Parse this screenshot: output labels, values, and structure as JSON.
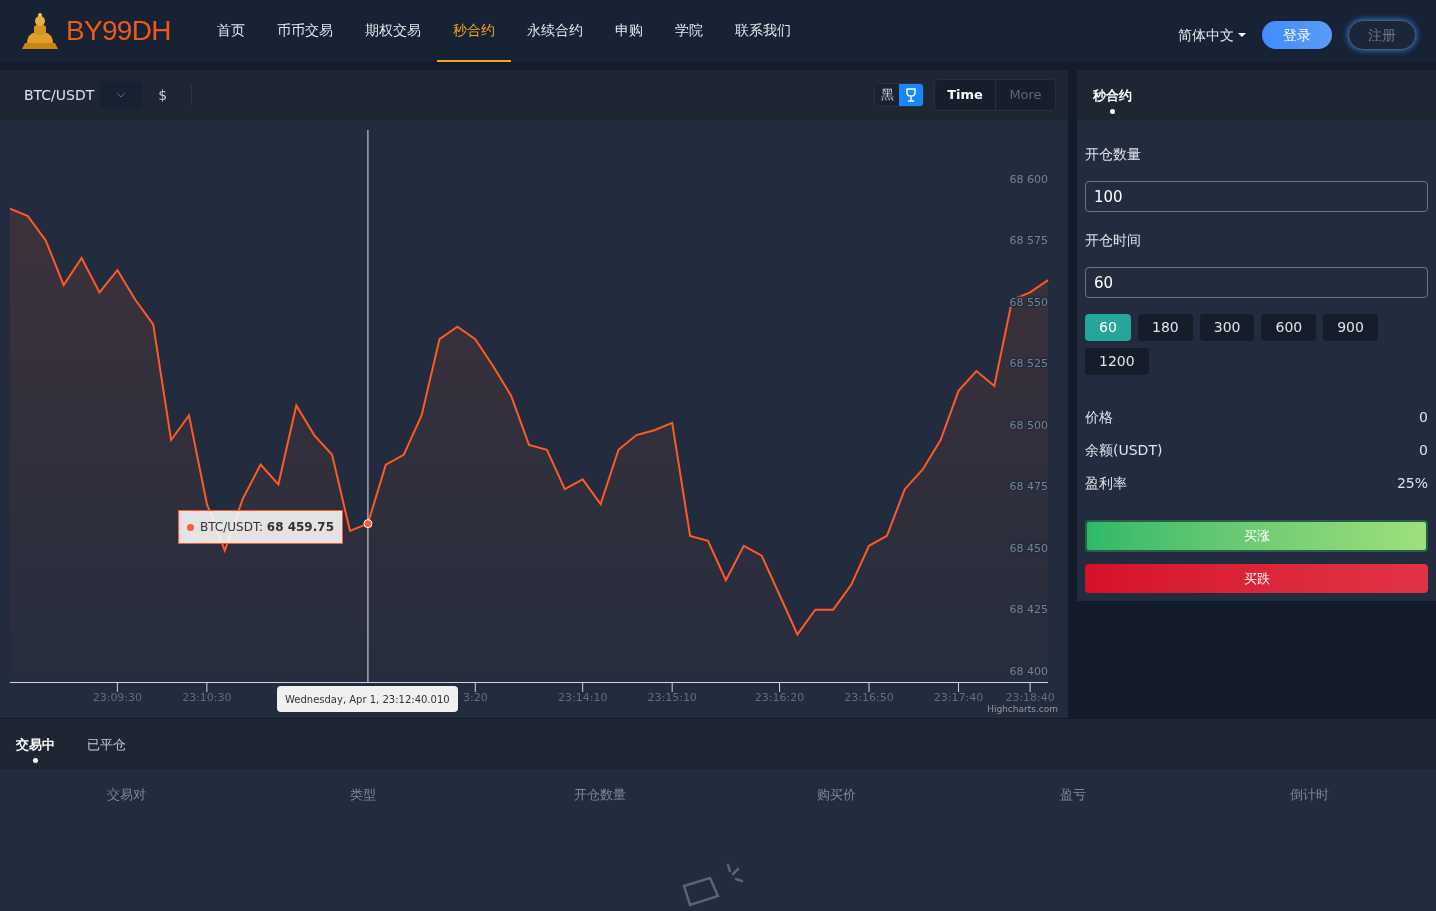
{
  "header": {
    "logo": "BY99DH",
    "nav": [
      {
        "label": "首页",
        "selected": false
      },
      {
        "label": "币币交易",
        "selected": false
      },
      {
        "label": "期权交易",
        "selected": false
      },
      {
        "label": "秒合约",
        "selected": true
      },
      {
        "label": "永续合约",
        "selected": false
      },
      {
        "label": "申购",
        "selected": false
      },
      {
        "label": "学院",
        "selected": false
      },
      {
        "label": "联系我们",
        "selected": false
      }
    ],
    "language": "简体中文",
    "login": "登录",
    "register": "注册"
  },
  "chart_panel": {
    "symbol": "BTC/USDT",
    "currency": "$",
    "theme_toggle": [
      {
        "kind": "text",
        "label": "黑",
        "selected": false
      },
      {
        "kind": "icon",
        "selected": true
      }
    ],
    "range_tabs": [
      {
        "label": "Time",
        "selected": true
      },
      {
        "label": "More",
        "selected": false
      }
    ],
    "chart_data": {
      "type": "area",
      "categories": [
        null,
        null,
        null,
        null,
        null,
        null,
        "23:09:30",
        null,
        null,
        null,
        null,
        "23:10:30",
        null,
        null,
        null,
        null,
        null,
        null,
        null,
        null,
        null,
        null,
        null,
        null,
        null,
        null,
        "3:20",
        null,
        null,
        null,
        null,
        null,
        "23:14:10",
        null,
        null,
        null,
        null,
        "23:15:10",
        null,
        null,
        null,
        null,
        null,
        "23:16:20",
        null,
        null,
        null,
        null,
        "23:16:50",
        null,
        null,
        null,
        null,
        "23:17:40",
        null,
        null,
        null,
        "23:18:40",
        null
      ],
      "series": [
        {
          "name": "BTC/USDT",
          "color": "#ff5a26",
          "values": [
            68588,
            68585,
            68575,
            68557,
            68568,
            68554,
            68563,
            68551,
            68541,
            68494,
            68504,
            68468,
            68449,
            68470,
            68484,
            68476,
            68508,
            68496,
            68488,
            68457,
            68460,
            68484,
            68488,
            68504,
            68535,
            68540,
            68535,
            68524,
            68512,
            68492,
            68490,
            68474,
            68478,
            68468,
            68490,
            68496,
            68498,
            68501,
            68455,
            68453,
            68437,
            68451,
            68447,
            68431,
            68415,
            68425,
            68425,
            68435,
            68451,
            68455,
            68474,
            68482,
            68494,
            68514,
            68522,
            68516,
            68551,
            68554,
            68559
          ]
        }
      ],
      "ylim": [
        68381,
        68620
      ],
      "yticks": [
        {
          "value": 68400,
          "label": "68 400"
        },
        {
          "value": 68425,
          "label": "68 425"
        },
        {
          "value": 68450,
          "label": "68 450"
        },
        {
          "value": 68475,
          "label": "68 475"
        },
        {
          "value": 68500,
          "label": "68 500"
        },
        {
          "value": 68525,
          "label": "68 525"
        },
        {
          "value": 68550,
          "label": "68 550"
        },
        {
          "value": 68575,
          "label": "68 575"
        },
        {
          "value": 68600,
          "label": "68 600"
        }
      ]
    },
    "tooltip": {
      "text": ": **68 459.75**",
      "date": "Wednesday, Apr 1, 23:12:40.010"
    },
    "credit": "Highcharts.com"
  },
  "order_panel": {
    "tabs": [
      {
        "label": "秒合约",
        "selected": true
      }
    ],
    "quantity_label": "开仓数量",
    "quantity": "100",
    "time_label": "开仓时间",
    "time": "60",
    "time_options": [
      {
        "label": "60",
        "selected": true
      },
      {
        "label": "180",
        "selected": false
      },
      {
        "label": "300",
        "selected": false
      },
      {
        "label": "600",
        "selected": false
      },
      {
        "label": "900",
        "selected": false
      },
      {
        "label": "1200",
        "selected": false
      }
    ],
    "info": [
      {
        "label": "价格",
        "value": "0"
      },
      {
        "label": "余额(USDT)",
        "value": "0"
      },
      {
        "label": "盈利率",
        "value": "25%"
      }
    ],
    "buy_up": "买涨",
    "buy_down": "买跌"
  },
  "positions": {
    "tabs": [
      {
        "label": "交易中",
        "selected": true
      },
      {
        "label": "已平仓",
        "selected": false
      }
    ],
    "columns": [
      "交易对",
      "类型",
      "开仓数量",
      "购买价",
      "盈亏",
      "倒计时"
    ]
  }
}
